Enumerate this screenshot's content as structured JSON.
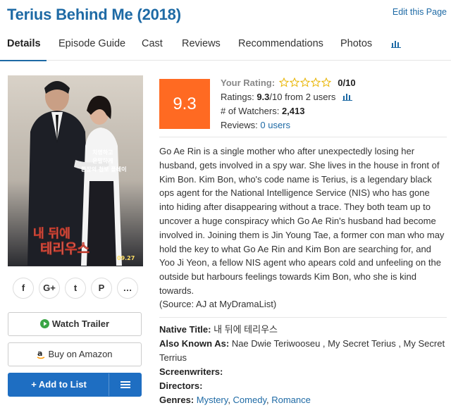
{
  "header": {
    "title": "Terius Behind Me (2018)",
    "edit_link": "Edit this Page"
  },
  "tabs": [
    {
      "label": "Details",
      "active": true
    },
    {
      "label": "Episode Guide"
    },
    {
      "label": "Cast"
    },
    {
      "label": "Reviews"
    },
    {
      "label": "Recommendations"
    },
    {
      "label": "Photos"
    }
  ],
  "stats_tab_icon": "bar-chart-icon",
  "poster": {
    "tagline": "치명하고 은밀하게 환장의 첩보 플레이",
    "logo": "내 뒤에 테리우스",
    "date": "09.27"
  },
  "share_icons": [
    "facebook-icon",
    "google-plus-icon",
    "twitter-icon",
    "pinterest-icon",
    "comments-icon"
  ],
  "share_glyphs": [
    "f",
    "G+",
    "t",
    "P",
    "…"
  ],
  "buttons": {
    "trailer": "Watch Trailer",
    "amazon": "Buy on Amazon",
    "add_list": "+ Add to List"
  },
  "rating": {
    "score": "9.3",
    "your_rating_label": "Your Rating:",
    "your_rating_value": "0/10",
    "ratings_label": "Ratings:",
    "ratings_value": "9.3",
    "ratings_suffix": "/10 from 2 users",
    "watchers_label": "# of Watchers:",
    "watchers_value": "2,413",
    "reviews_label": "Reviews:",
    "reviews_value": "0 users"
  },
  "synopsis": "Go Ae Rin is a single mother who after unexpectedly losing her husband, gets involved in a spy war. She lives in the house in front of Kim Bon. Kim Bon, who's code name is Terius, is a legendary black ops agent for the National Intelligence Service (NIS) who has gone into hiding after disappearing without a trace. They both team up to uncover a huge conspiracy which Go Ae Rin's husband had become involved in. Joining them is Jin Young Tae, a former con man who may hold the key to what Go Ae Rin and Kim Bon are searching for, and Yoo Ji Yeon, a fellow NIS agent who apears cold and unfeeling on the outside but harbours feelings towards Kim Bon, who she is kind towards.",
  "source": "(Source: AJ at MyDramaList)",
  "details": {
    "native_title_label": "Native Title:",
    "native_title": "내 뒤에 테리우스",
    "aka_label": "Also Known As:",
    "aka": "Nae Dwie Teriwooseu , My Secret Terius , My Secret Terrius",
    "screenwriters_label": "Screenwriters:",
    "directors_label": "Directors:",
    "genres_label": "Genres:",
    "genres": [
      "Mystery",
      "Comedy",
      "Romance"
    ],
    "genre_sep": ", "
  },
  "colors": {
    "accent": "#1e6aa5",
    "score_bg": "#ff6a22",
    "button_blue": "#1e6ec2"
  }
}
